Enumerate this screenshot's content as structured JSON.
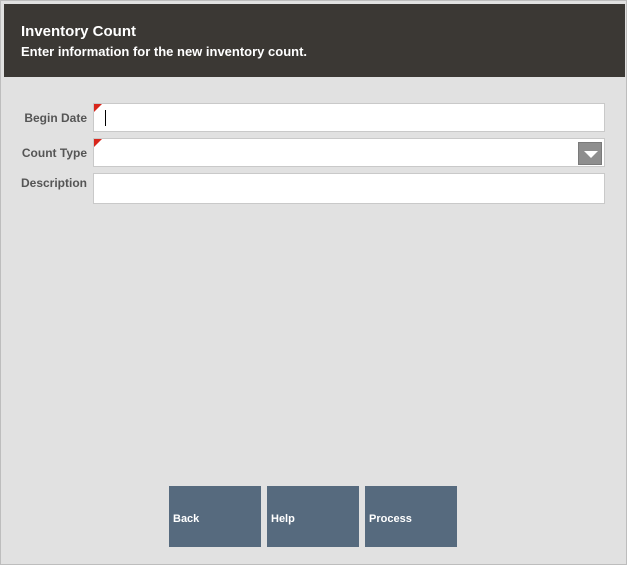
{
  "header": {
    "title": "Inventory Count",
    "subtitle": "Enter information for the new inventory count."
  },
  "form": {
    "begin_date": {
      "label": "Begin Date",
      "value": "",
      "required": true
    },
    "count_type": {
      "label": "Count Type",
      "value": "",
      "required": true
    },
    "description": {
      "label": "Description",
      "value": "",
      "required": false
    }
  },
  "buttons": {
    "back": "Back",
    "help": "Help",
    "process": "Process"
  },
  "colors": {
    "header_bg": "#3b3834",
    "body_bg": "#e1e1e1",
    "button_bg": "#566a7e",
    "required_flag": "#d8261c"
  }
}
